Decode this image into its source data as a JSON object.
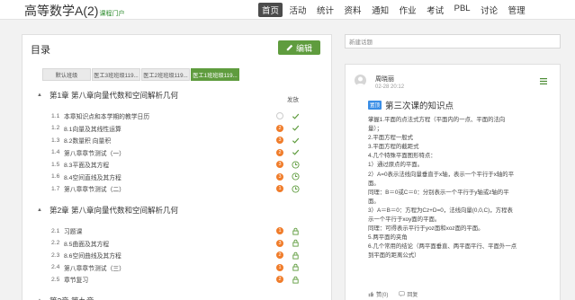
{
  "header": {
    "course_title": "高等数学A(2)",
    "course_sub": "课程门户",
    "nav": [
      "首页",
      "活动",
      "统计",
      "资料",
      "通知",
      "作业",
      "考试",
      "PBL",
      "讨论",
      "管理"
    ]
  },
  "catalog": {
    "title": "目录",
    "edit_label": "编辑",
    "tabs": [
      "默认班级",
      "医工3班班级119...",
      "医工2班班级119...",
      "医工1班班级119..."
    ],
    "status_header": "发放",
    "chapters": [
      {
        "title": "第1章 第八章向量代数和空间解析几何",
        "items": [
          {
            "num": "1.1",
            "title": "本章知识点和本学期的教学日历",
            "badge": "",
            "status": "check"
          },
          {
            "num": "1.2",
            "title": "8.1向量及其线性运算",
            "badge": "2",
            "status": "check"
          },
          {
            "num": "1.3",
            "title": "8.2数量积 向量积",
            "badge": "3",
            "status": "check"
          },
          {
            "num": "1.4",
            "title": "第八章章节测试（一）",
            "badge": "2",
            "status": "check"
          },
          {
            "num": "1.5",
            "title": "8.3平面及其方程",
            "badge": "3",
            "status": "clock"
          },
          {
            "num": "1.6",
            "title": "8.4空间直线及其方程",
            "badge": "3",
            "status": "clock"
          },
          {
            "num": "1.7",
            "title": "第八章章节测试（二）",
            "badge": "1",
            "status": "clock"
          }
        ]
      },
      {
        "title": "第2章 第八章向量代数和空间解析几何",
        "items": [
          {
            "num": "2.1",
            "title": "习题课",
            "badge": "1",
            "status": "lock"
          },
          {
            "num": "2.2",
            "title": "8.5曲面及其方程",
            "badge": "3",
            "status": "lock"
          },
          {
            "num": "2.3",
            "title": "8.6空间曲线及其方程",
            "badge": "2",
            "status": "lock"
          },
          {
            "num": "2.4",
            "title": "第八章章节测试（三）",
            "badge": "1",
            "status": "lock"
          },
          {
            "num": "2.5",
            "title": "章节复习",
            "badge": "2",
            "status": "lock"
          }
        ]
      },
      {
        "title": "第3章 第九章",
        "items": []
      }
    ]
  },
  "discussion": {
    "search_placeholder": "新建话题",
    "author": "周晓丽",
    "time": "02-28 20:12",
    "tag": "置顶",
    "title": "第三次课的知识点",
    "lines": [
      "掌握1.平面的点法式方程（平面内的一点、平面的法向",
      "量）；",
      "2.平面方程一般式",
      "3.平面方程的截距式",
      "4.几个特殊平面图形特点：",
      "1）通过原点的平面。",
      "2）A=0表示法线向量垂直于x轴，表示一个平行于x轴的平",
      "面。",
      "同理：B＝0或C＝0：分别表示一个平行于y轴或z轴的平",
      "面。",
      "3）A＝B＝0：方程为Cz+D=0，法线向量(0,0,C)，方程表",
      "示一个平行于xoy面的平面。",
      "同理：可得表示平行于yoz面和xoz面的平面。",
      "5.两平面的夹角",
      "6.几个常用的结论（两平面垂直、两平面平行、平面外一点",
      "到平面的距离公式）"
    ],
    "like_label": "赞(0)",
    "reply_label": "回复"
  }
}
